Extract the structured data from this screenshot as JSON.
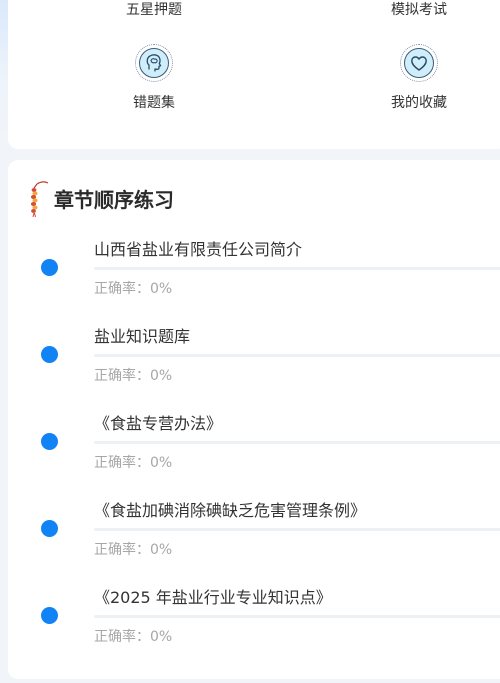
{
  "quick_entries": {
    "five_star": "五星押题",
    "mock_exam": "模拟考试",
    "wrong_questions": "错题集",
    "favorites": "我的收藏"
  },
  "icons": {
    "wrong_questions_icon": "head-brain-icon",
    "favorites_icon": "heart-icon",
    "chapter_icon": "firecracker-icon"
  },
  "colors": {
    "accent": "#1283f5",
    "page_bg": "#f1f4f9",
    "muted_text": "#a7a7a7"
  },
  "chapter_section": {
    "title": "章节顺序练习",
    "items": [
      {
        "title": "山西省盐业有限责任公司简介",
        "rate_label": "正确率：",
        "rate_value": "0%",
        "progress": 0
      },
      {
        "title": "盐业知识题库",
        "rate_label": "正确率：",
        "rate_value": "0%",
        "progress": 0
      },
      {
        "title": "《食盐专营办法》",
        "rate_label": "正确率：",
        "rate_value": "0%",
        "progress": 0
      },
      {
        "title": "《食盐加碘消除碘缺乏危害管理条例》",
        "rate_label": "正确率：",
        "rate_value": "0%",
        "progress": 0
      },
      {
        "title": "《2025 年盐业行业专业知识点》",
        "rate_label": "正确率：",
        "rate_value": "0%",
        "progress": 0
      }
    ]
  }
}
